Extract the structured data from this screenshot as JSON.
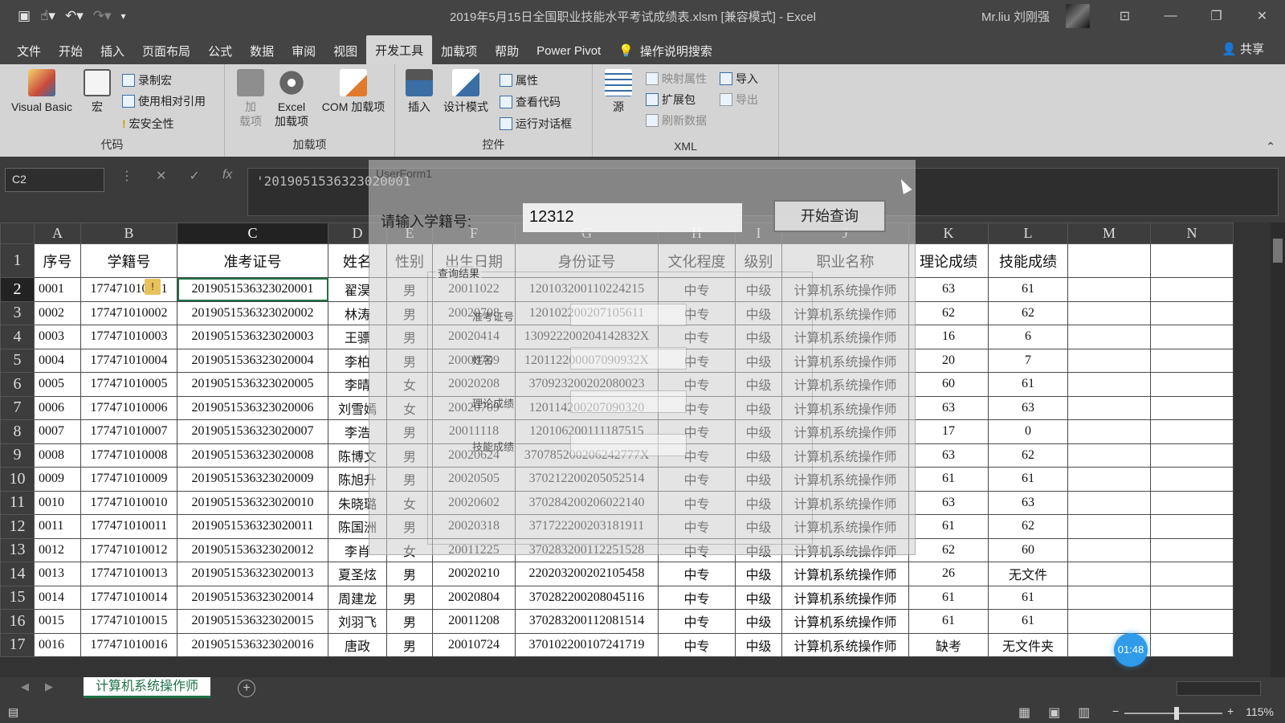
{
  "window": {
    "title": "2019年5月15日全国职业技能水平考试成绩表.xlsm  [兼容模式]  -  Excel",
    "user": "Mr.liu 刘刚强",
    "qat_icons": [
      "save-icon",
      "touch-mode-icon",
      "undo-icon",
      "redo-icon",
      "customize-icon"
    ]
  },
  "tabs": [
    "文件",
    "开始",
    "插入",
    "页面布局",
    "公式",
    "数据",
    "审阅",
    "视图",
    "开发工具",
    "加载项",
    "帮助",
    "Power Pivot",
    "操作说明搜索"
  ],
  "active_tab": "开发工具",
  "share": "共享",
  "ribbon": {
    "code": {
      "label": "代码",
      "visual_basic": "Visual Basic",
      "macro": "宏",
      "record": "录制宏",
      "relative": "使用相对引用",
      "security": "宏安全性"
    },
    "addins": {
      "label": "加载项",
      "add": "加\n载项",
      "excel_add": "Excel\n加载项",
      "com_add": "COM 加载项"
    },
    "controls": {
      "label": "控件",
      "insert": "插入",
      "design": "设计模式",
      "props": "属性",
      "view_code": "查看代码",
      "run_dialog": "运行对话框"
    },
    "xml": {
      "label": "XML",
      "source": "源",
      "map_props": "映射属性",
      "ext_pack": "扩展包",
      "refresh": "刷新数据",
      "import": "导入",
      "export": "导出"
    }
  },
  "formula_bar": {
    "name_box": "C2",
    "value": "'2019051536323020001"
  },
  "columns": [
    "A",
    "B",
    "C",
    "D",
    "E",
    "F",
    "G",
    "H",
    "I",
    "J",
    "K",
    "L",
    "M",
    "N"
  ],
  "headers": [
    "序号",
    "学籍号",
    "准考证号",
    "姓名",
    "性别",
    "出生日期",
    "身份证号",
    "文化程度",
    "级别",
    "职业名称",
    "理论成绩",
    "技能成绩"
  ],
  "rows": [
    [
      "0001",
      "177471010001",
      "2019051536323020001",
      "翟淏",
      "男",
      "20011022",
      "120103200110224215",
      "中专",
      "中级",
      "计算机系统操作师",
      "63",
      "61"
    ],
    [
      "0002",
      "177471010002",
      "2019051536323020002",
      "林涛",
      "男",
      "20020708",
      "120102200207105611",
      "中专",
      "中级",
      "计算机系统操作师",
      "62",
      "62"
    ],
    [
      "0003",
      "177471010003",
      "2019051536323020003",
      "王骠",
      "男",
      "20020414",
      "130922200204142832X",
      "中专",
      "中级",
      "计算机系统操作师",
      "16",
      "6"
    ],
    [
      "0004",
      "177471010004",
      "2019051536323020004",
      "李柏",
      "男",
      "20000709",
      "120112200007090932X",
      "中专",
      "中级",
      "计算机系统操作师",
      "20",
      "7"
    ],
    [
      "0005",
      "177471010005",
      "2019051536323020005",
      "李晴",
      "女",
      "20020208",
      "370923200202080023",
      "中专",
      "中级",
      "计算机系统操作师",
      "60",
      "61"
    ],
    [
      "0006",
      "177471010006",
      "2019051536323020006",
      "刘雪嫣",
      "女",
      "20020709",
      "120114200207090320",
      "中专",
      "中级",
      "计算机系统操作师",
      "63",
      "63"
    ],
    [
      "0007",
      "177471010007",
      "2019051536323020007",
      "李浩",
      "男",
      "20011118",
      "120106200111187515",
      "中专",
      "中级",
      "计算机系统操作师",
      "17",
      "0"
    ],
    [
      "0008",
      "177471010008",
      "2019051536323020008",
      "陈博文",
      "男",
      "20020624",
      "370785200206242777X",
      "中专",
      "中级",
      "计算机系统操作师",
      "63",
      "62"
    ],
    [
      "0009",
      "177471010009",
      "2019051536323020009",
      "陈旭升",
      "男",
      "20020505",
      "370212200205052514",
      "中专",
      "中级",
      "计算机系统操作师",
      "61",
      "61"
    ],
    [
      "0010",
      "177471010010",
      "2019051536323020010",
      "朱晓璐",
      "女",
      "20020602",
      "370284200206022140",
      "中专",
      "中级",
      "计算机系统操作师",
      "63",
      "63"
    ],
    [
      "0011",
      "177471010011",
      "2019051536323020011",
      "陈国洲",
      "男",
      "20020318",
      "371722200203181911",
      "中专",
      "中级",
      "计算机系统操作师",
      "61",
      "62"
    ],
    [
      "0012",
      "177471010012",
      "2019051536323020012",
      "李肖",
      "女",
      "20011225",
      "370283200112251528",
      "中专",
      "中级",
      "计算机系统操作师",
      "62",
      "60"
    ],
    [
      "0013",
      "177471010013",
      "2019051536323020013",
      "夏圣炫",
      "男",
      "20020210",
      "220203200202105458",
      "中专",
      "中级",
      "计算机系统操作师",
      "26",
      "无文件"
    ],
    [
      "0014",
      "177471010014",
      "2019051536323020014",
      "周建龙",
      "男",
      "20020804",
      "370282200208045116",
      "中专",
      "中级",
      "计算机系统操作师",
      "61",
      "61"
    ],
    [
      "0015",
      "177471010015",
      "2019051536323020015",
      "刘羽飞",
      "男",
      "20011208",
      "370283200112081514",
      "中专",
      "中级",
      "计算机系统操作师",
      "61",
      "61"
    ],
    [
      "0016",
      "177471010016",
      "2019051536323020016",
      "唐政",
      "男",
      "20010724",
      "370102200107241719",
      "中专",
      "中级",
      "计算机系统操作师",
      "缺考",
      "无文件夹"
    ]
  ],
  "row_numbers": [
    "1",
    "2",
    "3",
    "4",
    "5",
    "6",
    "7",
    "8",
    "9",
    "10",
    "11",
    "12",
    "13",
    "14",
    "15",
    "16",
    "17"
  ],
  "dialog": {
    "title": "UserForm1",
    "prompt": "请输入学籍号:",
    "input_value": "12312",
    "button": "开始查询",
    "frame_title": "查询结果",
    "fields": [
      "准考证号",
      "姓名",
      "理论成绩",
      "技能成绩"
    ]
  },
  "sheet_tab": "计算机系统操作师",
  "status": {
    "zoom": "115%"
  },
  "timer": "01:48"
}
